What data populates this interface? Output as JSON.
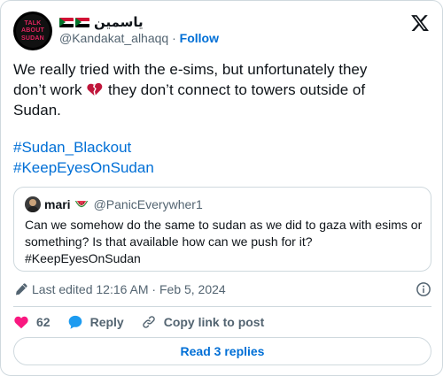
{
  "author": {
    "avatar_text": [
      "TALK",
      "ABOUT",
      "SUDAN"
    ],
    "display_name": "ياسمين",
    "handle": "@Kandakat_alhaqq",
    "separator": "·",
    "follow_label": "Follow"
  },
  "tweet": {
    "lines": [
      "We really tried with the e-sims, but unfortunately they",
      "don’t work",
      "they don’t connect to towers outside of",
      "Sudan."
    ],
    "hashtags": [
      "#Sudan_Blackout",
      "#KeepEyesOnSudan"
    ]
  },
  "quoted": {
    "name": "mari",
    "handle": "@PanicEverywher1",
    "text_lines": [
      "Can we somehow do the same to sudan as we did to gaza with esims or",
      "something? Is that available how can we push for it?",
      "#KeepEyesOnSudan"
    ]
  },
  "meta": {
    "edited": "Last edited 12:16 AM · Feb 5, 2024"
  },
  "actions": {
    "like_count": "62",
    "reply_label": "Reply",
    "copy_label": "Copy link to post"
  },
  "replies_button": "Read 3 replies",
  "colors": {
    "link": "#006fd6",
    "like": "#f91880",
    "reply": "#1d9bf0",
    "border": "#cfd9de",
    "muted": "#536471"
  },
  "icons": [
    "x-logo-icon",
    "broken-heart-icon",
    "watermelon-icon",
    "pencil-icon",
    "info-icon",
    "heart-icon",
    "reply-bubble-icon",
    "link-icon"
  ]
}
